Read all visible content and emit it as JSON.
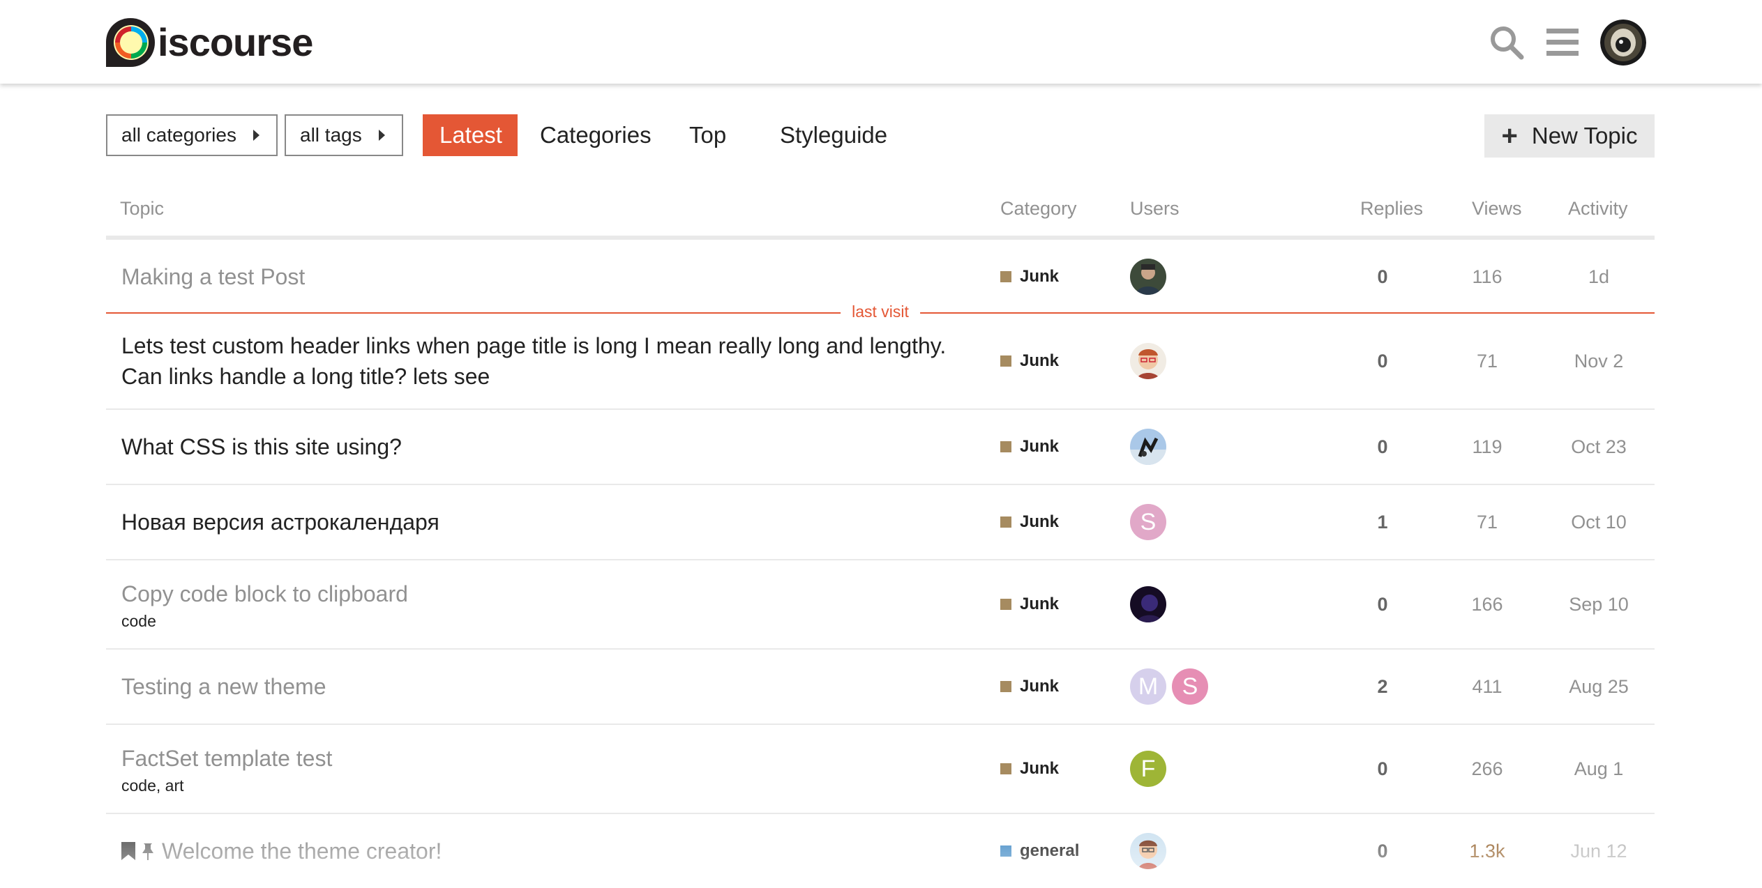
{
  "header": {
    "logo_text": "iscourse",
    "icons": [
      "search-icon",
      "hamburger-menu-icon",
      "user-avatar"
    ]
  },
  "nav": {
    "categories_dropdown": "all categories",
    "tags_dropdown": "all tags",
    "tabs": [
      {
        "label": "Latest",
        "active": true
      },
      {
        "label": "Categories",
        "active": false
      },
      {
        "label": "Top",
        "active": false
      },
      {
        "label": "Styleguide",
        "active": false
      }
    ],
    "new_topic_label": "New Topic"
  },
  "table": {
    "headers": {
      "topic": "Topic",
      "category": "Category",
      "users": "Users",
      "replies": "Replies",
      "views": "Views",
      "activity": "Activity"
    },
    "last_visit_label": "last visit",
    "rows": [
      {
        "title": "Making a test Post",
        "tags": "",
        "category": "Junk",
        "replies": "0",
        "views": "116",
        "activity": "1d"
      },
      {
        "title_line1": "Lets test custom header links when page title is long I mean really long and lengthy.",
        "title_line2": "Can links handle a long title? lets see",
        "tags": "",
        "category": "Junk",
        "replies": "0",
        "views": "71",
        "activity": "Nov 2"
      },
      {
        "title": "What CSS is this site using?",
        "tags": "",
        "category": "Junk",
        "replies": "0",
        "views": "119",
        "activity": "Oct 23"
      },
      {
        "title": "Новая версия астрокалендаря",
        "tags": "",
        "category": "Junk",
        "replies": "1",
        "views": "71",
        "activity": "Oct 10",
        "avatar_letter": "S"
      },
      {
        "title": "Copy code block to clipboard",
        "tags": "code",
        "category": "Junk",
        "replies": "0",
        "views": "166",
        "activity": "Sep 10"
      },
      {
        "title": "Testing a new theme",
        "tags": "",
        "category": "Junk",
        "replies": "2",
        "views": "411",
        "activity": "Aug 25",
        "avatar_letters": [
          "M",
          "S"
        ]
      },
      {
        "title": "FactSet template test",
        "tags": "code, art",
        "category": "Junk",
        "replies": "0",
        "views": "266",
        "activity": "Aug 1",
        "avatar_letter": "F"
      },
      {
        "title": "Welcome the theme creator!",
        "tags": "",
        "category": "general",
        "replies": "0",
        "views": "1.3k",
        "activity": "Jun 12"
      }
    ]
  },
  "colors": {
    "accent": "#e45735",
    "junk_category": "#a68b60",
    "general_category": "#4a90c8",
    "muted_text": "#919191"
  }
}
